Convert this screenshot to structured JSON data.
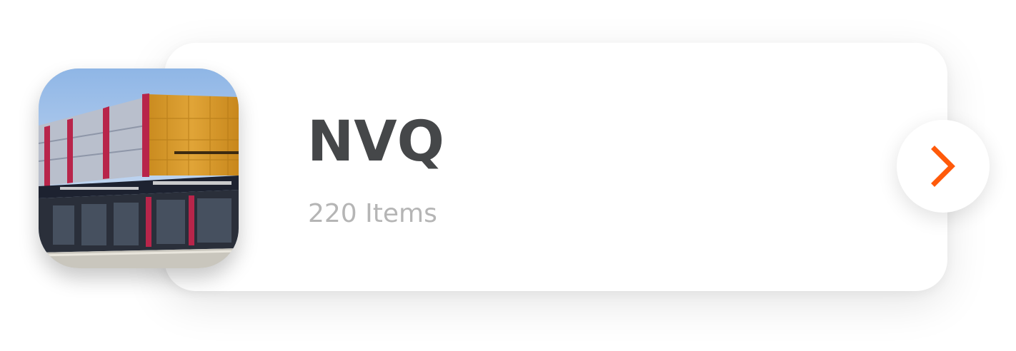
{
  "category": {
    "title": "NVQ",
    "item_count": "220 Items",
    "accent_color": "#ff5a0a",
    "image": "storefront-building-photo",
    "next_icon": "chevron-right-icon"
  }
}
